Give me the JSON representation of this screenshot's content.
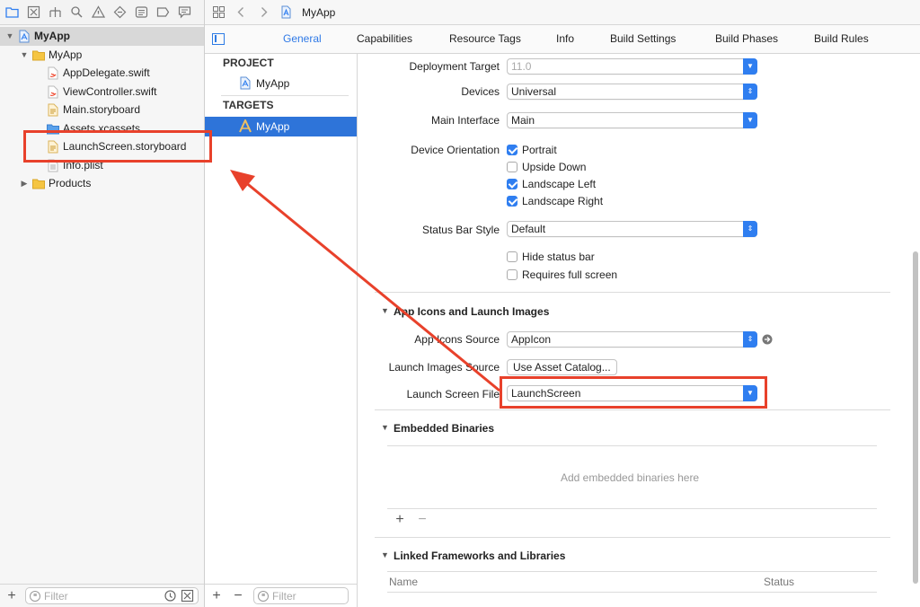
{
  "navigator": {
    "tree": [
      {
        "label": "MyApp",
        "indent": 0,
        "icon": "project-icon",
        "disclosure": "open",
        "selected": true
      },
      {
        "label": "MyApp",
        "indent": 1,
        "icon": "folder-icon",
        "disclosure": "open"
      },
      {
        "label": "AppDelegate.swift",
        "indent": 2,
        "icon": "swift-file-icon"
      },
      {
        "label": "ViewController.swift",
        "indent": 2,
        "icon": "swift-file-icon"
      },
      {
        "label": "Main.storyboard",
        "indent": 2,
        "icon": "storyboard-file-icon"
      },
      {
        "label": "Assets.xcassets",
        "indent": 2,
        "icon": "asset-folder-icon"
      },
      {
        "label": "LaunchScreen.storyboard",
        "indent": 2,
        "icon": "storyboard-file-icon"
      },
      {
        "label": "Info.plist",
        "indent": 2,
        "icon": "plist-file-icon"
      },
      {
        "label": "Products",
        "indent": 1,
        "icon": "folder-icon",
        "disclosure": "closed"
      }
    ],
    "filter_placeholder": "Filter"
  },
  "editor": {
    "breadcrumb": "MyApp",
    "tabs": [
      "General",
      "Capabilities",
      "Resource Tags",
      "Info",
      "Build Settings",
      "Build Phases",
      "Build Rules"
    ],
    "active_tab": "General"
  },
  "targets": {
    "project_header": "PROJECT",
    "project_item": "MyApp",
    "targets_header": "TARGETS",
    "target_item": "MyApp",
    "filter_placeholder": "Filter"
  },
  "settings": {
    "deployment_target": {
      "label": "Deployment Target",
      "value": "11.0"
    },
    "devices": {
      "label": "Devices",
      "value": "Universal"
    },
    "main_interface": {
      "label": "Main Interface",
      "value": "Main"
    },
    "device_orientation": {
      "label": "Device Orientation",
      "options": [
        {
          "label": "Portrait",
          "checked": true
        },
        {
          "label": "Upside Down",
          "checked": false
        },
        {
          "label": "Landscape Left",
          "checked": true
        },
        {
          "label": "Landscape Right",
          "checked": true
        }
      ]
    },
    "status_bar_style": {
      "label": "Status Bar Style",
      "value": "Default"
    },
    "hide_status_bar": {
      "label": "Hide status bar",
      "checked": false
    },
    "requires_full_screen": {
      "label": "Requires full screen",
      "checked": false
    },
    "app_icons_section": "App Icons and Launch Images",
    "app_icons_source": {
      "label": "App Icons Source",
      "value": "AppIcon"
    },
    "launch_images_source": {
      "label": "Launch Images Source",
      "button": "Use Asset Catalog..."
    },
    "launch_screen_file": {
      "label": "Launch Screen File",
      "value": "LaunchScreen"
    },
    "embedded_section": "Embedded Binaries",
    "embedded_hint": "Add embedded binaries here",
    "linked_section": "Linked Frameworks and Libraries",
    "linked_columns": {
      "name": "Name",
      "status": "Status"
    }
  },
  "colors": {
    "accent": "#2f7ef0",
    "annotation": "#e8412b",
    "selection": "#2e74d9"
  }
}
